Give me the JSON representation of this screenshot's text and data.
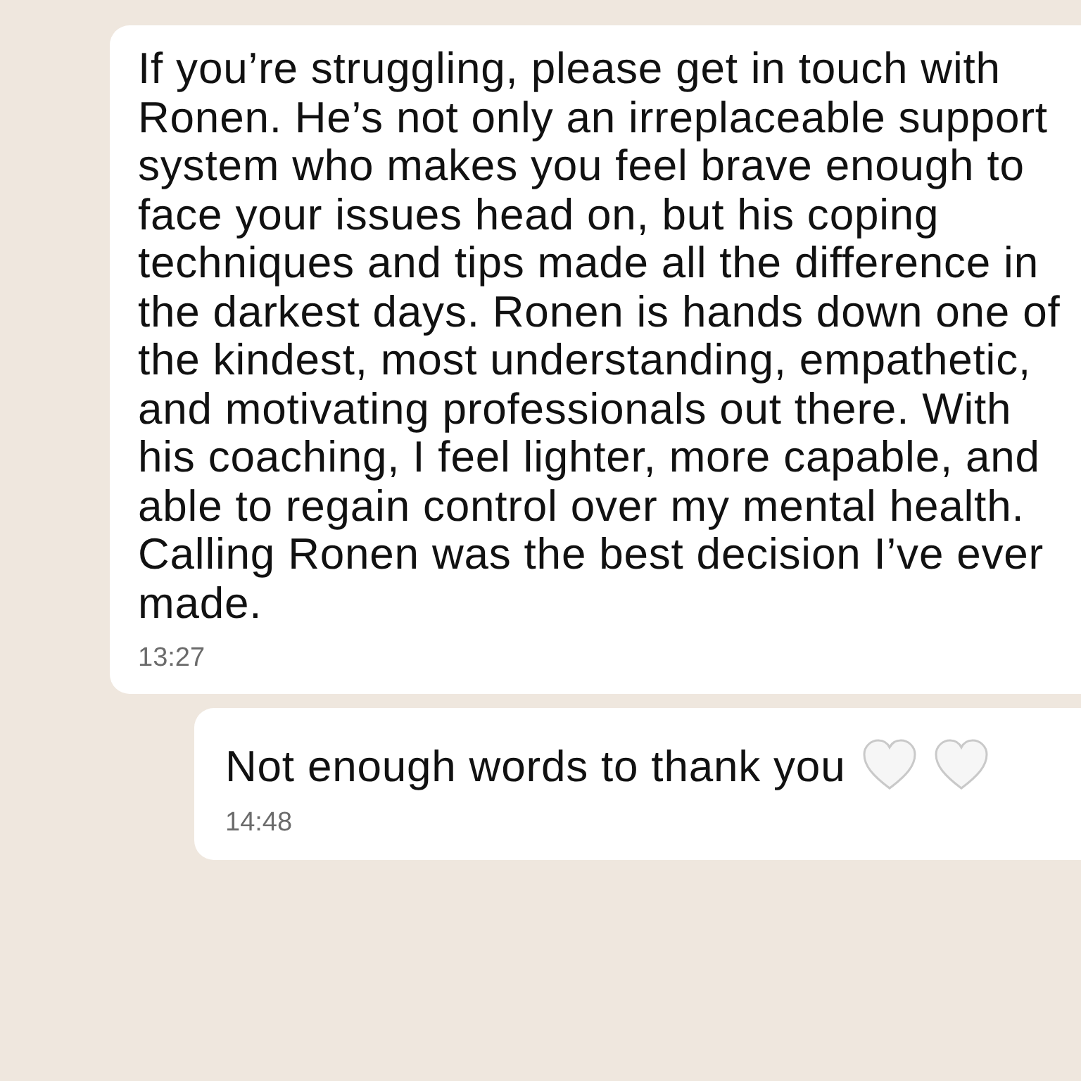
{
  "messages": [
    {
      "text": "If you’re struggling, please get in touch with Ronen. He’s not only an irreplaceable support system who makes you feel brave enough to face your issues head on, but his coping techniques and tips made all the difference in the darkest days. Ronen is hands down one of the kindest, most understanding, empathetic, and motivating professionals out there. With his coaching, I feel lighter, more capable, and able to regain control over my mental health. Calling Ronen was the best decision I’ve ever made.",
      "time": "13:27"
    },
    {
      "text": "Not enough words to thank you",
      "time": "14:48",
      "emoji": [
        {
          "kind": "heart"
        },
        {
          "kind": "heart"
        }
      ]
    }
  ]
}
